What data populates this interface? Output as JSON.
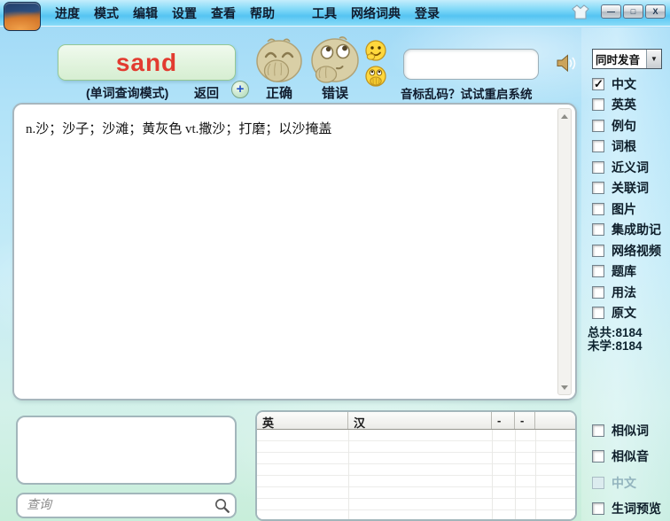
{
  "titlebar": {
    "menu_items": [
      "进度",
      "模式",
      "编辑",
      "设置",
      "查看",
      "帮助",
      "工具",
      "网络词典",
      "登录"
    ],
    "minimize_glyph": "—",
    "maximize_glyph": "□",
    "close_glyph": "X"
  },
  "word_panel": {
    "word": "sand",
    "mode_label": "(单词查询模式)",
    "back_label": "返回",
    "plus_glyph": "+",
    "correct_label": "正确",
    "wrong_label": "错误",
    "answer_input_value": "",
    "phonetic_tip": "音标乱码？试试重启系统"
  },
  "definition_text": "n.沙；沙子；沙滩；黄灰色 vt.撒沙；打磨；以沙掩盖",
  "sidebar": {
    "pronounce_mode": "同时发音",
    "dropdown_arrow_glyph": "▼",
    "display_options": [
      {
        "label": "中文",
        "checked": true,
        "disabled": false
      },
      {
        "label": "英英",
        "checked": false,
        "disabled": false
      },
      {
        "label": "例句",
        "checked": false,
        "disabled": false
      },
      {
        "label": "词根",
        "checked": false,
        "disabled": false
      },
      {
        "label": "近义词",
        "checked": false,
        "disabled": false
      },
      {
        "label": "关联词",
        "checked": false,
        "disabled": false
      },
      {
        "label": "图片",
        "checked": false,
        "disabled": false
      },
      {
        "label": "集成助记",
        "checked": false,
        "disabled": false
      },
      {
        "label": "网络视频",
        "checked": false,
        "disabled": false
      },
      {
        "label": "题库",
        "checked": false,
        "disabled": false
      },
      {
        "label": "用法",
        "checked": false,
        "disabled": false
      },
      {
        "label": "原文",
        "checked": false,
        "disabled": false
      }
    ],
    "total_label": "总共:8184",
    "unlearned_label": "未学:8184",
    "match_options": [
      {
        "label": "相似词",
        "checked": false,
        "disabled": false
      },
      {
        "label": "相似音",
        "checked": false,
        "disabled": false
      },
      {
        "label": "中文",
        "checked": false,
        "disabled": true
      },
      {
        "label": "生词预览",
        "checked": false,
        "disabled": false
      }
    ]
  },
  "search": {
    "placeholder": "查询"
  },
  "wordlist_table": {
    "headers": [
      "英",
      "汉",
      "-",
      "-",
      ""
    ]
  },
  "colors": {
    "titlebar_blue": "#55c4f2",
    "word_text_red": "#e23b30",
    "word_box_green": "#e0f3dc",
    "background_sky": "#b2e3f8"
  }
}
